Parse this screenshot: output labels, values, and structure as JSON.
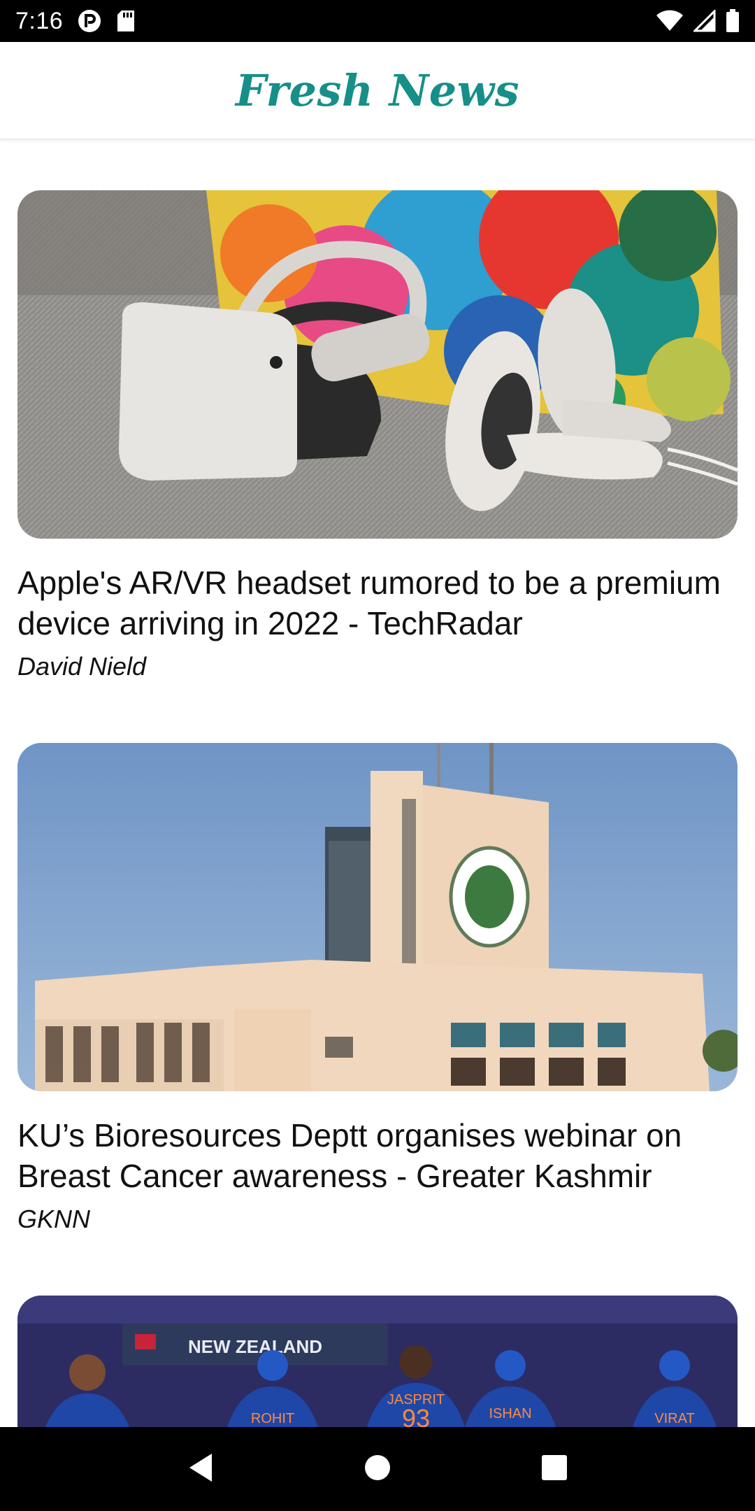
{
  "status_bar": {
    "time": "7:16"
  },
  "app_bar": {
    "title": "Fresh News"
  },
  "articles": [
    {
      "title": "Apple's AR/VR headset rumored to be a premium device arriving in 2022 - TechRadar",
      "author": "David Nield",
      "image_subject": "vr-headset-on-sofa"
    },
    {
      "title": "KU’s Bioresources Deptt organises webinar on Breast Cancer awareness - Greater Kashmir",
      "author": "GKNN",
      "image_subject": "university-building"
    },
    {
      "title": "",
      "author": "",
      "image_subject": "cricket-team",
      "image_text": {
        "banner": "NEW ZEALAND",
        "jerseys": [
          "ROHIT",
          "JASPRIT",
          "ISHAN",
          "VIRAT"
        ],
        "number": "93"
      }
    }
  ],
  "colors": {
    "accent": "#168f88",
    "status_bar_bg": "#000000",
    "nav_bar_bg": "#000000"
  },
  "icons": {
    "status": [
      "notification-p-icon",
      "sd-card-icon",
      "wifi-icon",
      "cell-signal-icon",
      "battery-icon"
    ],
    "nav": [
      "back-icon",
      "home-icon",
      "recents-icon"
    ]
  }
}
